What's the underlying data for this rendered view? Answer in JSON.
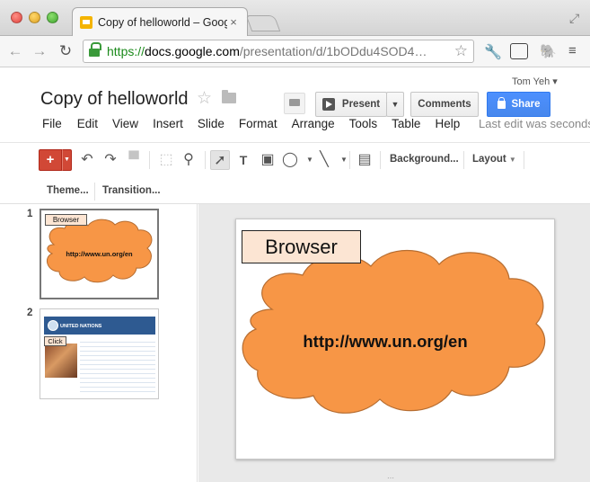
{
  "browser": {
    "tab_title": "Copy of helloworld – Goog",
    "tab_close": "×",
    "url_scheme": "https://",
    "url_host": "docs.google.com",
    "url_path": "/presentation/d/1bODdu4SOD4…"
  },
  "header": {
    "user_name": "Tom Yeh ▾",
    "doc_title": "Copy of helloworld",
    "present_label": "Present",
    "comments_label": "Comments",
    "share_label": "Share",
    "last_edit": "Last edit was seconds ago"
  },
  "menu": [
    "File",
    "Edit",
    "View",
    "Insert",
    "Slide",
    "Format",
    "Arrange",
    "Tools",
    "Table",
    "Help"
  ],
  "toolbar": {
    "add_label": "+",
    "background_label": "Background...",
    "layout_label": "Layout",
    "theme_label": "Theme...",
    "transition_label": "Transition..."
  },
  "filmstrip": [
    {
      "number": "1",
      "label": "Browser",
      "url": "http://www.un.org/en"
    },
    {
      "number": "2",
      "label": "Click",
      "header_text": "UNITED NATIONS"
    }
  ],
  "slide": {
    "label": "Browser",
    "url": "http://www.un.org/en"
  },
  "colors": {
    "cloud_fill": "#f79646",
    "cloud_stroke": "#b66d31",
    "label_fill": "#fce5d3",
    "share_blue": "#4d90fe",
    "add_red": "#d14836"
  }
}
